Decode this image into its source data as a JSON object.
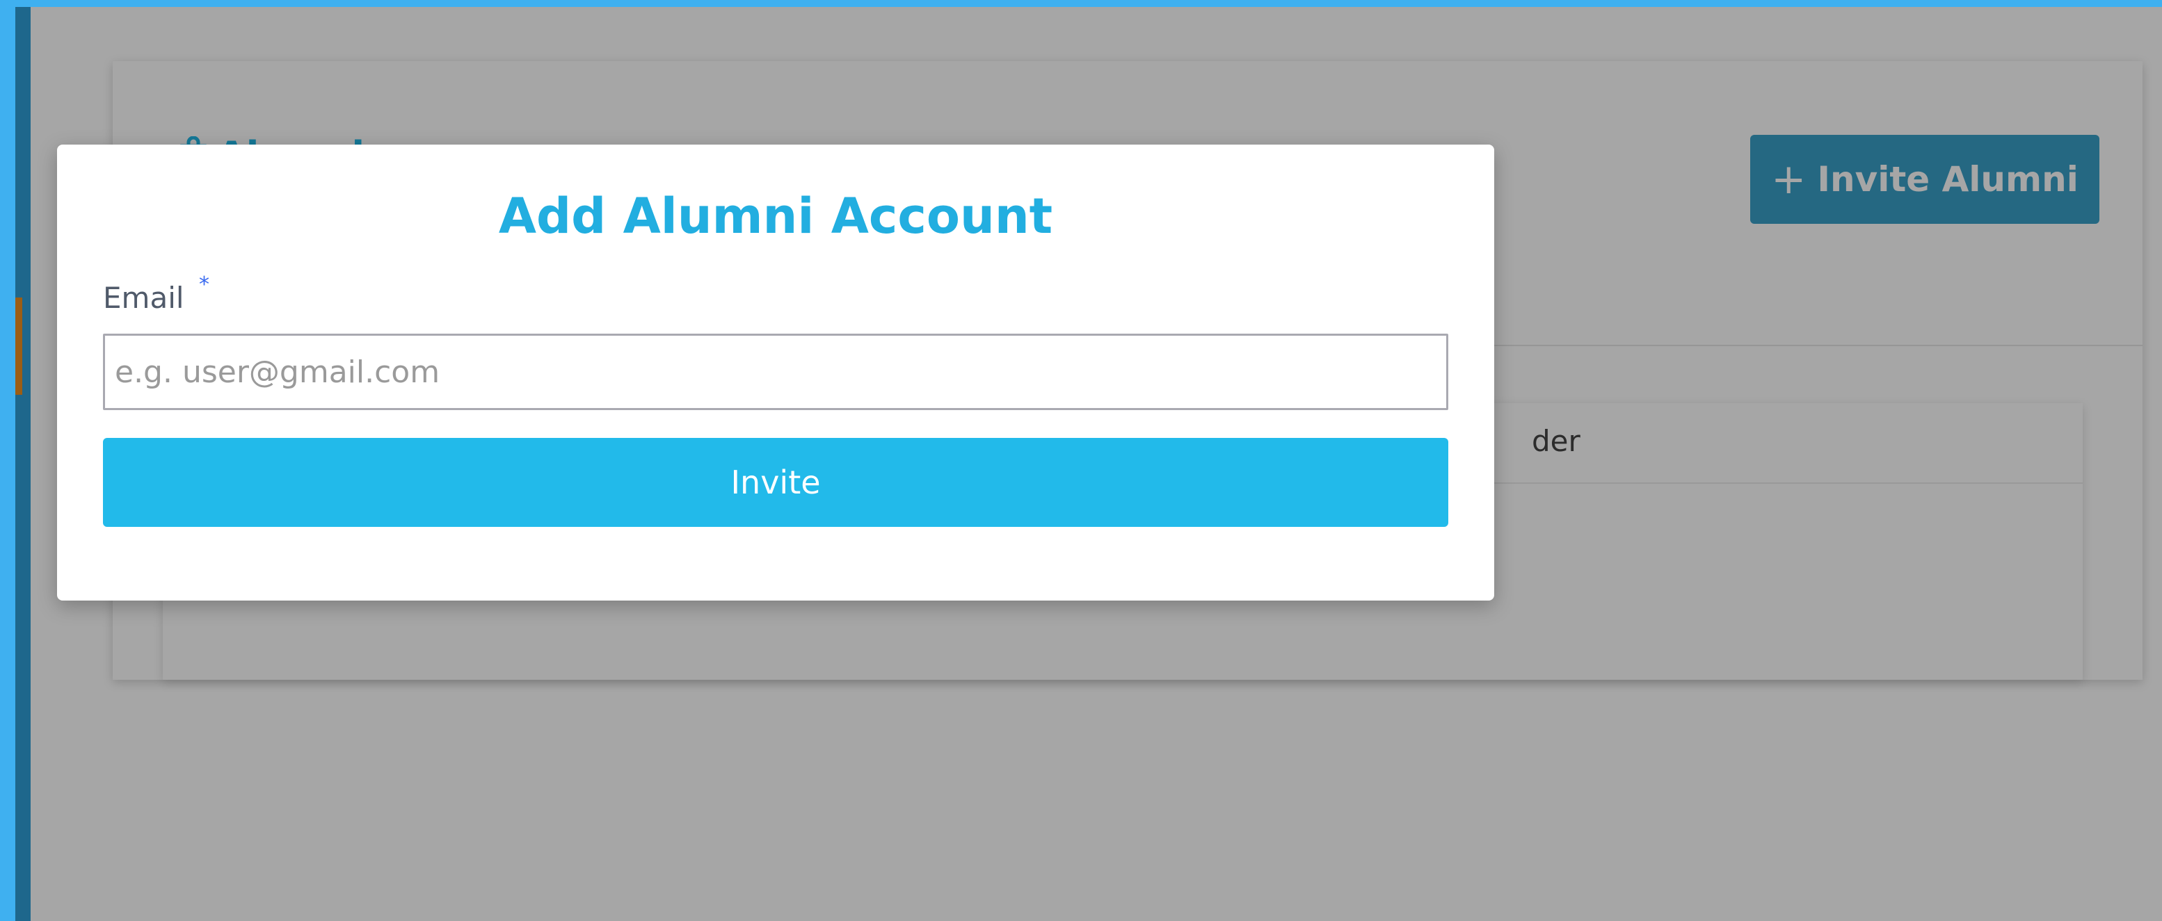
{
  "background_page": {
    "title": "Alumni",
    "invite_alumni_button_label": "Invite Alumni",
    "invite_alumni_button_icon": "plus-icon",
    "table_header_partial": "der"
  },
  "modal": {
    "title": "Add Alumni Account",
    "email_label": "Email",
    "required_marker": "*",
    "email_placeholder": "e.g. user@gmail.com",
    "email_value": "",
    "invite_button_label": "Invite"
  },
  "colors": {
    "accent": "#22baea",
    "title": "#22aee0",
    "frame": "#3fb0f0"
  }
}
